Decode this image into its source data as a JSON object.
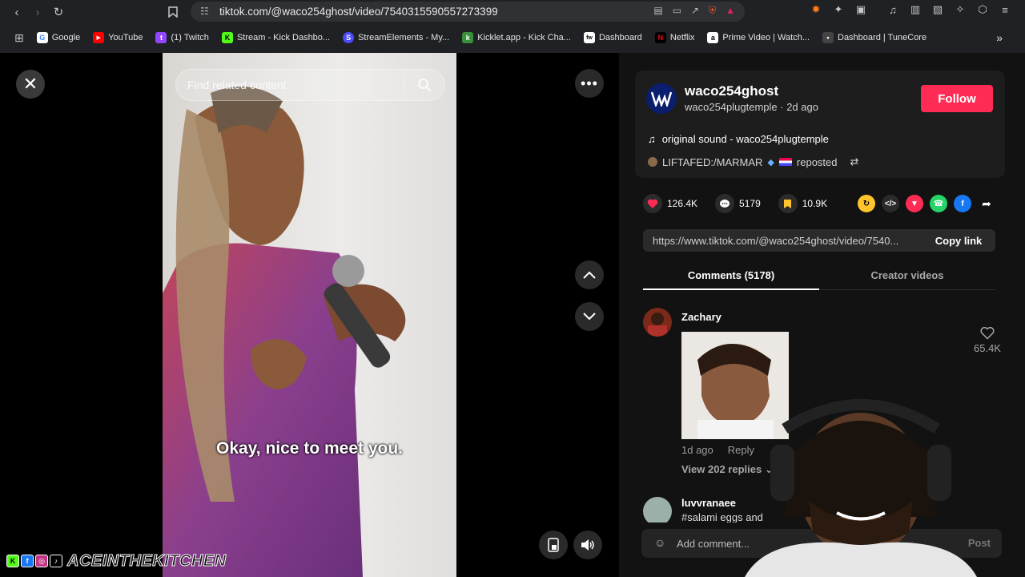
{
  "browser": {
    "url": "tiktok.com/@waco254ghost/video/7540315590557273399",
    "bookmarks": [
      {
        "label": "Google",
        "color": "#ffffff",
        "glyph": "G"
      },
      {
        "label": "YouTube",
        "color": "#ff0000",
        "glyph": "▶"
      },
      {
        "label": "(1) Twitch",
        "color": "#9146ff",
        "glyph": "t"
      },
      {
        "label": "Stream - Kick Dashbo...",
        "color": "#53fc18",
        "glyph": "K"
      },
      {
        "label": "StreamElements - My...",
        "color": "#4b4bff",
        "glyph": "S"
      },
      {
        "label": "Kicklet.app - Kick Cha...",
        "color": "#3a8f3a",
        "glyph": "k"
      },
      {
        "label": "Dashboard",
        "color": "#ffffff",
        "glyph": "fw"
      },
      {
        "label": "Netflix",
        "color": "#e50914",
        "glyph": "N"
      },
      {
        "label": "Prime Video | Watch...",
        "color": "#ffffff",
        "glyph": "a"
      },
      {
        "label": "Dashboard | TuneCore",
        "color": "#444444",
        "glyph": "•"
      }
    ],
    "more_bookmarks": "»"
  },
  "video": {
    "search_placeholder": "Find related content",
    "caption": "Okay, nice to meet you."
  },
  "post": {
    "username": "waco254ghost",
    "subline": "waco254plugtemple · 2d ago",
    "follow_label": "Follow",
    "sound": "original sound - waco254plugtemple",
    "reposter": "LIFTAFED:/MARMAR",
    "repost_label": "reposted",
    "likes": "126.4K",
    "comments": "5179",
    "saves": "10.9K",
    "link": "https://www.tiktok.com/@waco254ghost/video/7540...",
    "copy_label": "Copy link",
    "accent": "#fe2c55"
  },
  "tabs": [
    {
      "label": "Comments (5178)",
      "active": true
    },
    {
      "label": "Creator videos",
      "active": false
    }
  ],
  "comments": [
    {
      "name": "Zachary",
      "age": "1d ago",
      "reply_label": "Reply",
      "replies": "View 202 replies",
      "likes": "65.4K"
    },
    {
      "name": "luvvranaee",
      "text": "#salami eggs and"
    }
  ],
  "composer": {
    "placeholder": "Add comment...",
    "post_label": "Post"
  },
  "overlay": {
    "brand": "ACEINTHEKITCHEN"
  }
}
